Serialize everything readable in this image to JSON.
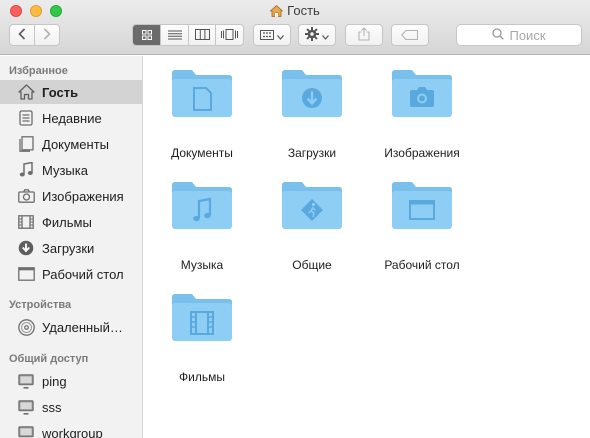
{
  "window": {
    "title": "Гость",
    "title_icon": "home-icon"
  },
  "toolbar": {
    "back_icon": "chevron-left-icon",
    "forward_icon": "chevron-right-icon",
    "views": [
      "icon-view",
      "list-view",
      "column-view",
      "cover-flow-view"
    ],
    "active_view": "icon-view",
    "arrange_icon": "arrange-grid-icon",
    "action_icon": "gear-icon",
    "share_icon": "share-icon",
    "tag_icon": "tag-icon",
    "search_placeholder": "Поиск"
  },
  "sidebar": {
    "favorites_header": "Избранное",
    "favorites": [
      {
        "label": "Гость",
        "icon": "home-icon",
        "selected": true
      },
      {
        "label": "Недавние",
        "icon": "recents-icon"
      },
      {
        "label": "Документы",
        "icon": "document-icon"
      },
      {
        "label": "Музыка",
        "icon": "music-icon"
      },
      {
        "label": "Изображения",
        "icon": "camera-icon"
      },
      {
        "label": "Фильмы",
        "icon": "film-icon"
      },
      {
        "label": "Загрузки",
        "icon": "download-icon"
      },
      {
        "label": "Рабочий стол",
        "icon": "desktop-icon"
      }
    ],
    "devices_header": "Устройства",
    "devices": [
      {
        "label": "Удаленный…",
        "icon": "disc-icon"
      }
    ],
    "shared_header": "Общий доступ",
    "shared": [
      {
        "label": "ping",
        "icon": "computer-icon"
      },
      {
        "label": "sss",
        "icon": "computer-icon"
      },
      {
        "label": "workgroup",
        "icon": "computer-icon"
      }
    ]
  },
  "folders": [
    {
      "label": "Документы",
      "glyph": "document"
    },
    {
      "label": "Загрузки",
      "glyph": "download"
    },
    {
      "label": "Изображения",
      "glyph": "camera"
    },
    {
      "label": "Музыка",
      "glyph": "music"
    },
    {
      "label": "Общие",
      "glyph": "public"
    },
    {
      "label": "Рабочий стол",
      "glyph": "desktop"
    },
    {
      "label": "Фильмы",
      "glyph": "film"
    }
  ],
  "colors": {
    "folder_body": "#8ecdf4",
    "folder_tab": "#7ac0ec",
    "folder_glyph": "#5aa9de",
    "sidebar_icon": "#6e6e6e",
    "selection": "#d3d3d3"
  }
}
